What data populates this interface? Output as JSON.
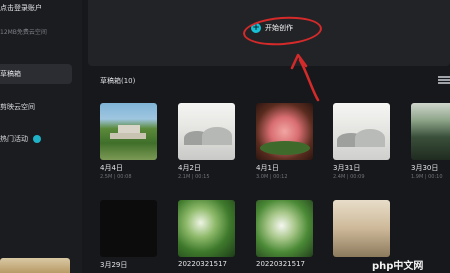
{
  "sidebar": {
    "login_label": "点击登录账户",
    "cloud_space_label": "12MB免费云空间",
    "items": [
      {
        "label": "草稿箱"
      },
      {
        "label": "剪映云空间"
      },
      {
        "label": "热门活动"
      }
    ]
  },
  "create": {
    "button_label": "开始创作"
  },
  "drafts": {
    "title": "草稿箱(10)",
    "cards": [
      {
        "date": "4月4日",
        "meta": "2.5M | 00:08"
      },
      {
        "date": "4月2日",
        "meta": "2.1M | 00:15"
      },
      {
        "date": "4月1日",
        "meta": "3.0M | 00:12"
      },
      {
        "date": "3月31日",
        "meta": "2.4M | 00:09"
      },
      {
        "date": "3月30日",
        "meta": "1.9M | 00:10"
      },
      {
        "date": "3月29日",
        "meta": ""
      },
      {
        "date": "20220321517",
        "meta": ""
      },
      {
        "date": "20220321517",
        "meta": ""
      },
      {
        "date": "",
        "meta": ""
      }
    ]
  },
  "annotation": {
    "color": "#d42a2a"
  },
  "watermark": "php中文网"
}
